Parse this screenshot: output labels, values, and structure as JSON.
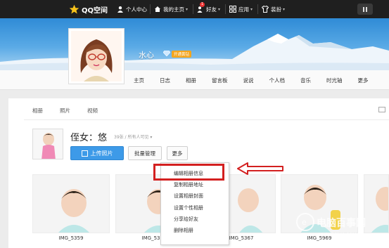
{
  "topbar": {
    "logo": "QQ空间",
    "items": [
      {
        "label": "个人中心"
      },
      {
        "label": "我的主页"
      },
      {
        "label": "好友",
        "badge": "1"
      },
      {
        "label": "应用"
      },
      {
        "label": "装扮"
      }
    ]
  },
  "profile": {
    "username": "水心",
    "vip_badge": "开通黄钻",
    "tabs": [
      "主页",
      "日志",
      "相册",
      "留言板",
      "说说",
      "个人档",
      "音乐",
      "时光轴",
      "更多"
    ]
  },
  "album": {
    "subtabs": [
      "相册",
      "照片",
      "视频"
    ],
    "title": "侄女：悠",
    "meta": "39张 / 所有人可见",
    "upload_button": "上传照片",
    "manage_button": "批量管理",
    "more_button": "更多",
    "photos": [
      {
        "caption": "IMG_5359"
      },
      {
        "caption": "IMG_5363"
      },
      {
        "caption": "IMG_5367"
      },
      {
        "caption": "IMG_5969"
      },
      {
        "caption": ""
      }
    ]
  },
  "menu": {
    "items": [
      "编辑相册信息",
      "复制相册地址",
      "设置相册封面",
      "设置个性相册",
      "分享给好友",
      "删除相册"
    ]
  },
  "watermark": {
    "line1": "电脑百事网",
    "line2": "WWW.PC841.COM"
  }
}
